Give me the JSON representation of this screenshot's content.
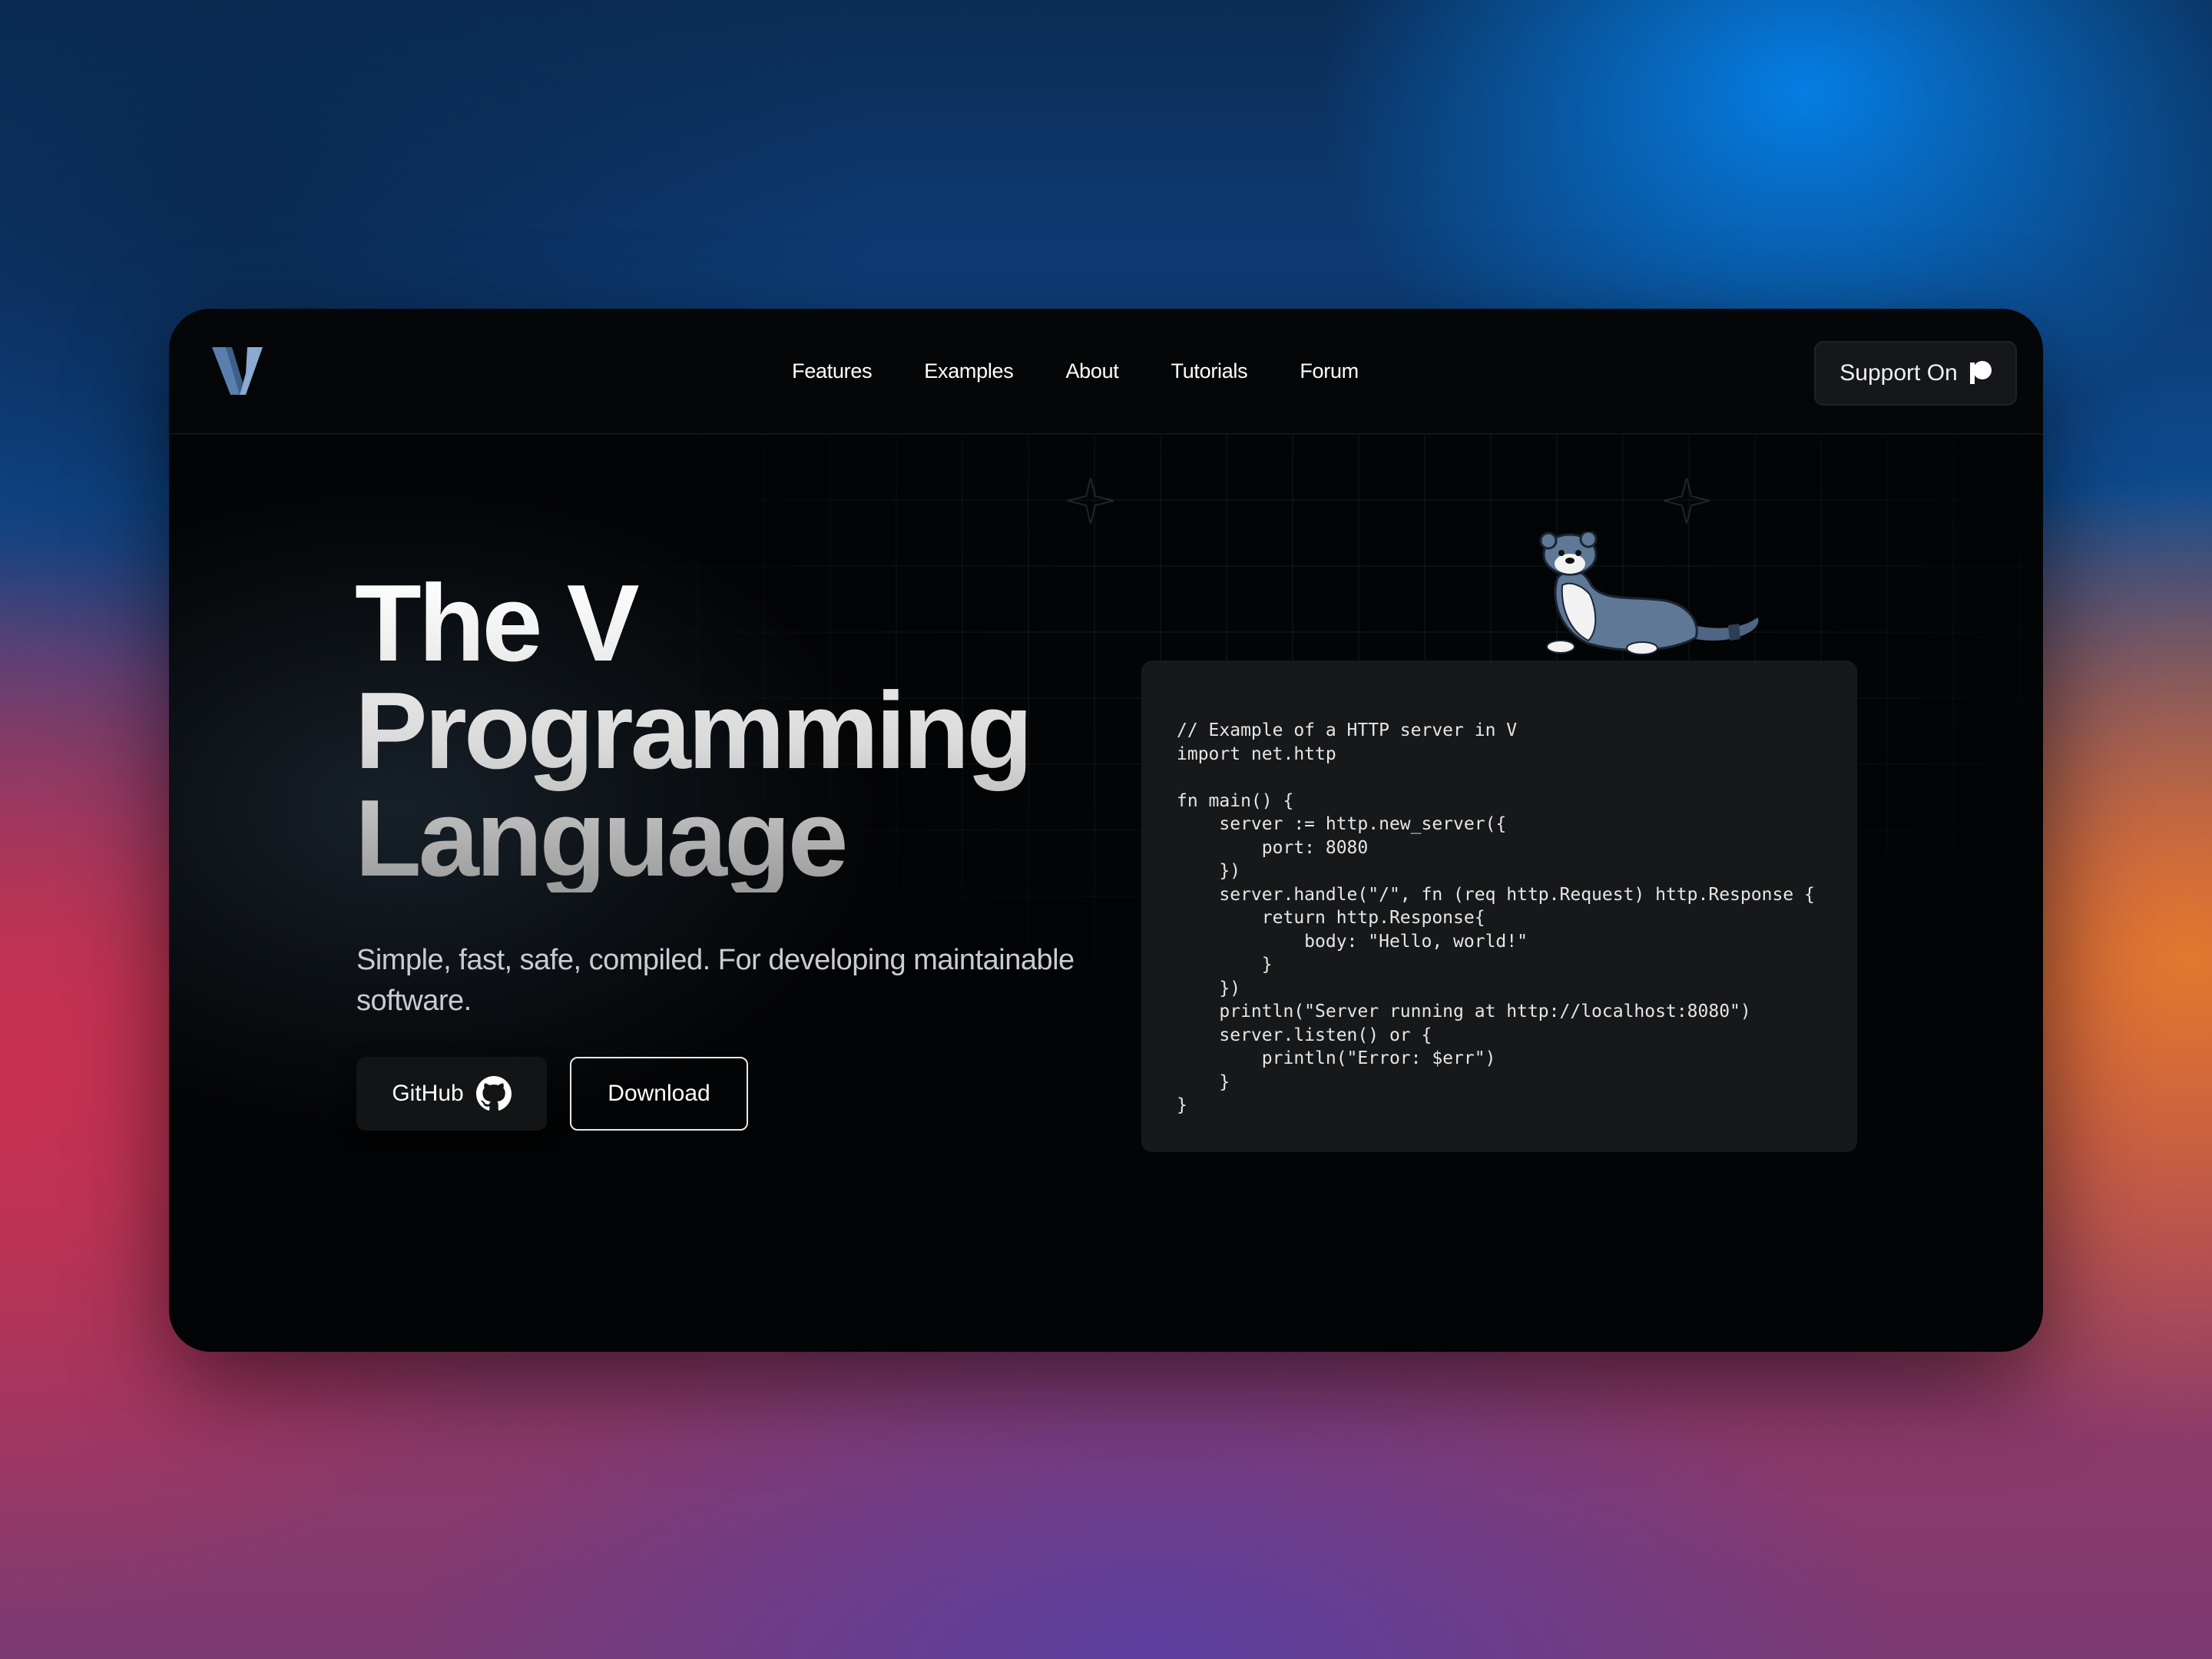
{
  "nav": {
    "logo_icon": "v-logo-icon",
    "links": [
      "Features",
      "Examples",
      "About",
      "Tutorials",
      "Forum"
    ],
    "support_label": "Support On",
    "support_icon": "patreon-icon"
  },
  "hero": {
    "title_lines": [
      "The V",
      "Programming",
      "Language"
    ],
    "subtitle": "Simple, fast, safe, compiled. For developing maintainable software.",
    "github_label": "GitHub",
    "github_icon": "github-icon",
    "download_label": "Download",
    "mascot_icon": "weasel-mascot-icon"
  },
  "code": {
    "lines": [
      "// Example of a HTTP server in V",
      "import net.http",
      "",
      "fn main() {",
      "    server := http.new_server({",
      "        port: 8080",
      "    })",
      "    server.handle(\"/\", fn (req http.Request) http.Response {",
      "        return http.Response{",
      "            body: \"Hello, world!\"",
      "        }",
      "    })",
      "    println(\"Server running at http://localhost:8080\")",
      "    server.listen() or {",
      "        println(\"Error: $err\")",
      "    }",
      "}"
    ]
  },
  "colors": {
    "logo_light": "#8fb0d4",
    "logo_dark": "#4f6f99",
    "page_bg": "#030405",
    "code_bg": "#17181a"
  }
}
